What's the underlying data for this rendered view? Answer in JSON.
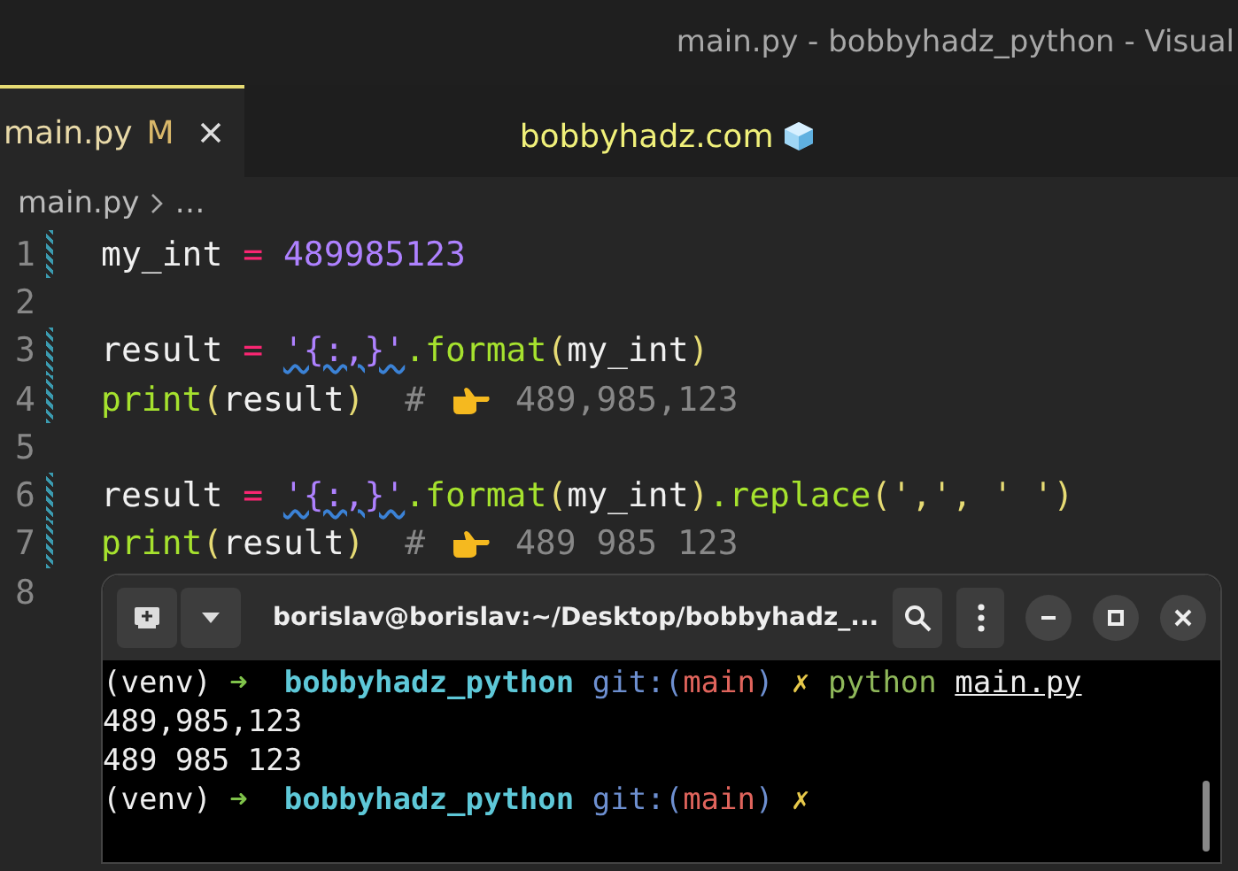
{
  "window": {
    "title": "main.py - bobbyhadz_python - Visual"
  },
  "tabs": [
    {
      "label": "main.py",
      "badge": "M",
      "selected": true
    }
  ],
  "banner": "bobbyhadz.com",
  "breadcrumb": {
    "file": "main.py",
    "rest": "…"
  },
  "code_lines": [
    {
      "number": "1",
      "modified": true,
      "tokens": [
        {
          "kind": "var",
          "text": "my_int "
        },
        {
          "kind": "op",
          "text": "="
        },
        {
          "kind": "num",
          "text": " 489985123"
        }
      ]
    },
    {
      "number": "2",
      "modified": false
    },
    {
      "number": "3",
      "modified": true,
      "tokens": [
        {
          "kind": "var",
          "text": "result "
        },
        {
          "kind": "op",
          "text": "= "
        },
        {
          "kind": "str",
          "text": "'{:,}'"
        },
        {
          "kind": "func",
          "text": ".format"
        },
        {
          "kind": "paren",
          "text": "("
        },
        {
          "kind": "var",
          "text": "my_int"
        },
        {
          "kind": "paren",
          "text": ")"
        }
      ]
    },
    {
      "number": "4",
      "modified": true,
      "tokens": [
        {
          "kind": "func",
          "text": "print"
        },
        {
          "kind": "paren",
          "text": "("
        },
        {
          "kind": "var",
          "text": "result"
        },
        {
          "kind": "paren",
          "text": ")"
        },
        {
          "kind": "comment",
          "text": "  # "
        },
        {
          "kind": "hand"
        },
        {
          "kind": "comment",
          "text": " 489,985,123"
        }
      ]
    },
    {
      "number": "5",
      "modified": false
    },
    {
      "number": "6",
      "modified": true,
      "tokens": [
        {
          "kind": "var",
          "text": "result "
        },
        {
          "kind": "op",
          "text": "= "
        },
        {
          "kind": "str",
          "text": "'{:,}'"
        },
        {
          "kind": "func",
          "text": ".format"
        },
        {
          "kind": "paren",
          "text": "("
        },
        {
          "kind": "var",
          "text": "my_int"
        },
        {
          "kind": "paren",
          "text": ")"
        },
        {
          "kind": "func",
          "text": ".replace"
        },
        {
          "kind": "paren",
          "text": "("
        },
        {
          "kind": "plain",
          "text": "',', ' '"
        },
        {
          "kind": "paren",
          "text": ")"
        }
      ]
    },
    {
      "number": "7",
      "modified": true,
      "tokens": [
        {
          "kind": "func",
          "text": "print"
        },
        {
          "kind": "paren",
          "text": "("
        },
        {
          "kind": "var",
          "text": "result"
        },
        {
          "kind": "paren",
          "text": ")"
        },
        {
          "kind": "comment",
          "text": "  # "
        },
        {
          "kind": "hand"
        },
        {
          "kind": "comment",
          "text": " 489 985 123"
        }
      ]
    },
    {
      "number": "8",
      "modified": false
    }
  ],
  "terminal": {
    "title": "borislav@borislav:~/Desktop/bobbyhadz_...",
    "lines": [
      [
        {
          "kind": "plain",
          "text": "(venv) "
        },
        {
          "kind": "arrow",
          "text": "➜"
        },
        {
          "kind": "dir",
          "text": "  bobbyhadz_python "
        },
        {
          "kind": "git",
          "text": "git:("
        },
        {
          "kind": "branch",
          "text": "main"
        },
        {
          "kind": "git",
          "text": ")"
        },
        {
          "kind": "mark",
          "text": " ✗ "
        },
        {
          "kind": "cmd",
          "text": "python "
        },
        {
          "kind": "arg",
          "text": "main.py"
        }
      ],
      [
        {
          "kind": "plain",
          "text": "489,985,123"
        }
      ],
      [
        {
          "kind": "plain",
          "text": "489 985 123"
        }
      ],
      [
        {
          "kind": "plain",
          "text": "(venv) "
        },
        {
          "kind": "arrow",
          "text": "➜"
        },
        {
          "kind": "dir",
          "text": "  bobbyhadz_python "
        },
        {
          "kind": "git",
          "text": "git:("
        },
        {
          "kind": "branch",
          "text": "main"
        },
        {
          "kind": "git",
          "text": ")"
        },
        {
          "kind": "mark",
          "text": " ✗"
        }
      ]
    ]
  }
}
